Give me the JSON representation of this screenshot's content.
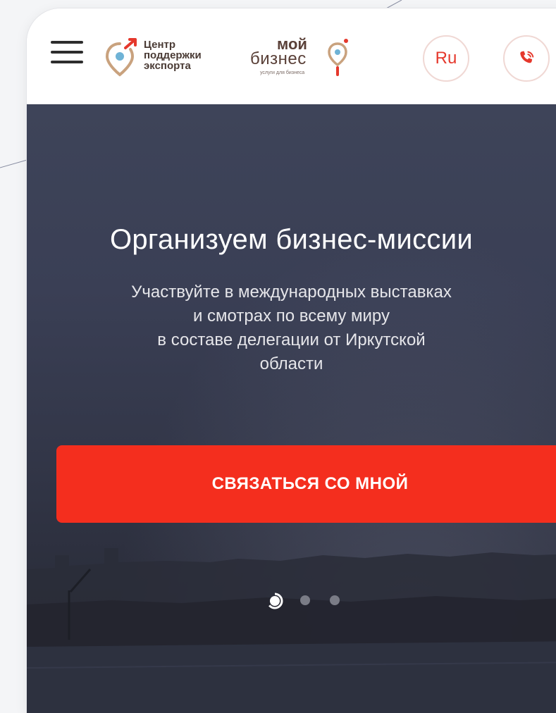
{
  "header": {
    "menu_icon": "hamburger-menu-icon",
    "export_center_logo": {
      "lines": [
        "Центр",
        "поддержки",
        "экспорта"
      ],
      "icon": "location-pin-arrow-icon",
      "accent_color": "#e5382c"
    },
    "my_business_logo": {
      "word1": "мой",
      "word2": "бизнес",
      "tagline": "услуги для бизнеса",
      "icon": "location-pin-icon",
      "accent_color": "#e5382c"
    },
    "language_button": "Ru",
    "phone_icon": "phone-call-icon"
  },
  "hero": {
    "title": "Организуем бизнес-миссии",
    "subtitle_lines": [
      "Участвуйте в международных выставках",
      "и смотрах по всему миру",
      "в составе делегации от Иркутской",
      "области"
    ],
    "cta_label": "СВЯЗАТЬСЯ СО МНОЙ",
    "cta_color": "#f42e1e",
    "slider": {
      "total": 3,
      "active_index": 1
    }
  }
}
